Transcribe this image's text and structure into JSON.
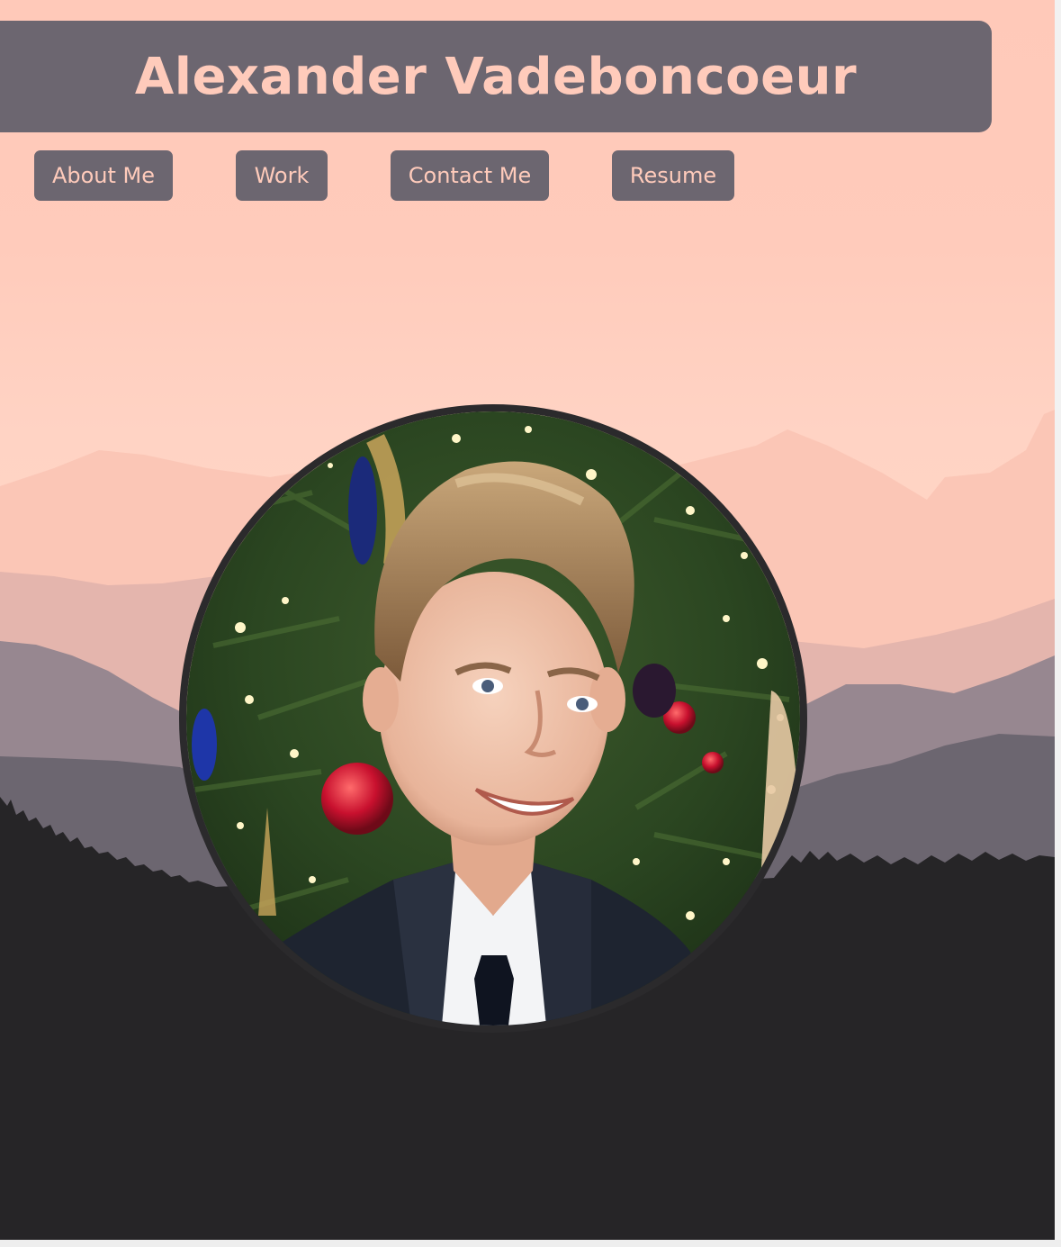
{
  "header": {
    "title": "Alexander Vadeboncoeur"
  },
  "nav": {
    "items": [
      {
        "label": "About Me"
      },
      {
        "label": "Work"
      },
      {
        "label": "Contact Me"
      },
      {
        "label": "Resume"
      }
    ]
  },
  "colors": {
    "accent": "#ffcbbb",
    "panel": "#6c6670",
    "dark": "#262527"
  },
  "hero": {
    "image": "profile-photo",
    "background": "mountain-landscape"
  }
}
